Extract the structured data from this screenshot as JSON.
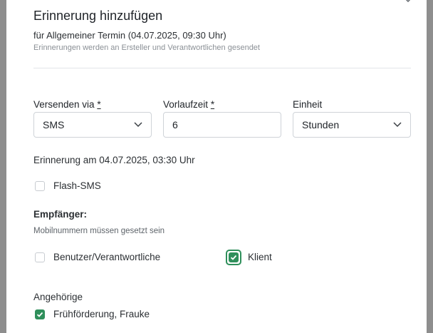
{
  "dialog": {
    "title": "Erinnerung hinzufügen",
    "subtitle": "für Allgemeiner Termin (04.07.2025, 09:30 Uhr)",
    "hint": "Erinnerungen werden an Ersteller und Verantwortlichen gesendet"
  },
  "form": {
    "via": {
      "label": "Versenden via",
      "required_mark": "*",
      "value": "SMS"
    },
    "lead_time": {
      "label": "Vorlaufzeit",
      "required_mark": "*",
      "value": "6"
    },
    "unit": {
      "label": "Einheit",
      "value": "Stunden"
    },
    "reminder_at": "Erinnerung am 04.07.2025, 03:30 Uhr",
    "flash_sms": {
      "label": "Flash-SMS",
      "checked": false
    },
    "recipients": {
      "heading": "Empfänger:",
      "note": "Mobilnummern müssen gesetzt sein",
      "users": {
        "label": "Benutzer/Verantwortliche",
        "checked": false
      },
      "client": {
        "label": "Klient",
        "checked": true
      }
    },
    "relatives": {
      "heading": "Angehörige",
      "items": [
        {
          "label": "Frühförderung, Frauke",
          "checked": true
        }
      ]
    }
  },
  "colors": {
    "accent": "#2f8f5b",
    "border": "#cfd3d8",
    "backdrop": "#8e8e8e"
  },
  "icons": {
    "close": "close-icon",
    "dropdown": "chevron-down-icon",
    "check": "check-icon"
  }
}
